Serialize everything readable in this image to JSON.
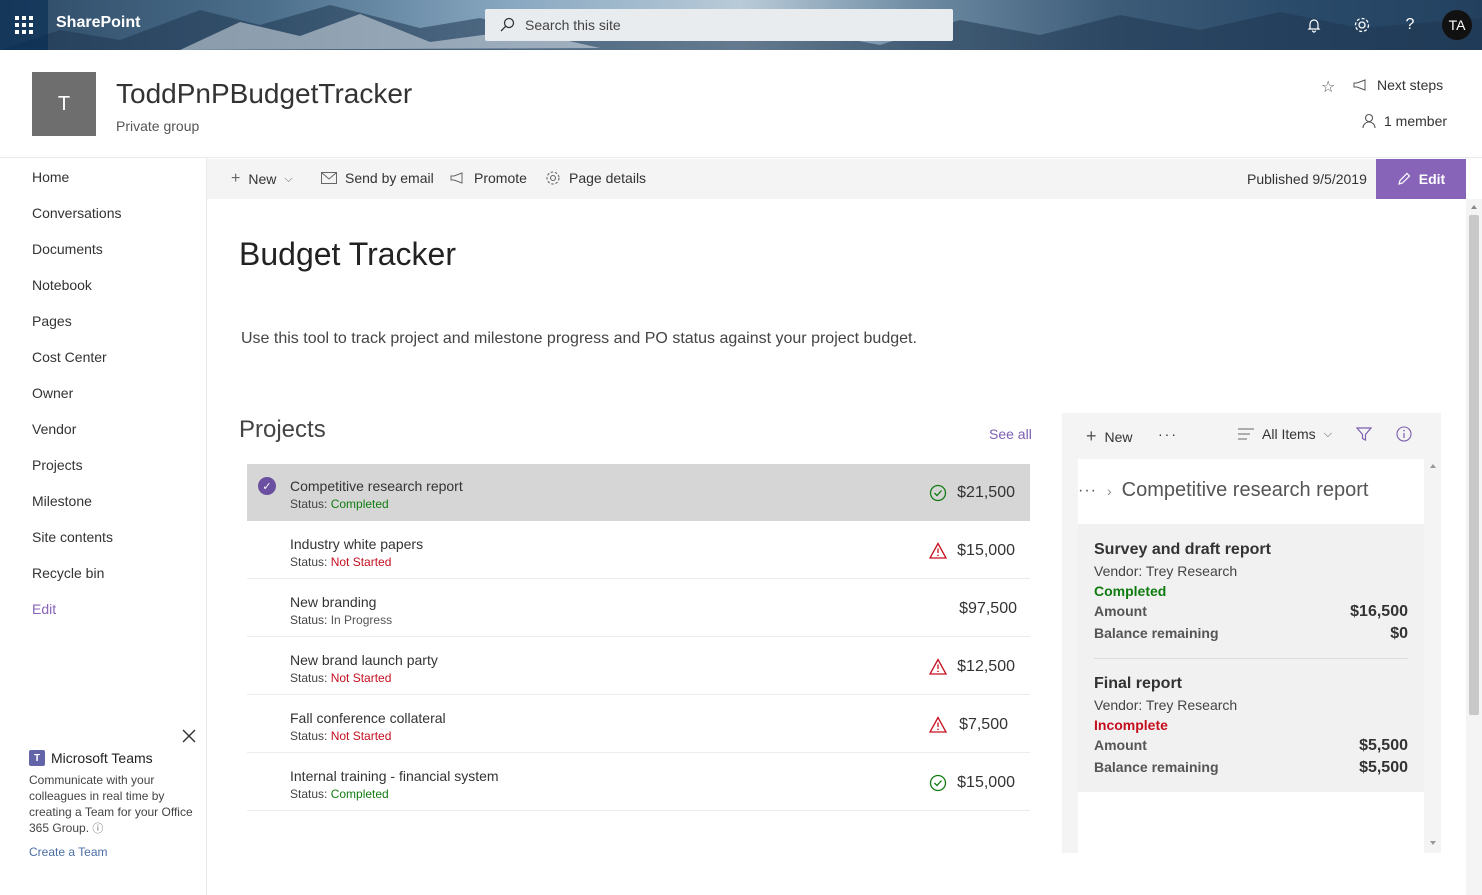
{
  "suite": {
    "brand": "SharePoint",
    "search_placeholder": "Search this site",
    "avatar_initials": "TA"
  },
  "site": {
    "logo_letter": "T",
    "title": "ToddPnPBudgetTracker",
    "subtitle": "Private group",
    "next_steps": "Next steps",
    "members": "1 member"
  },
  "nav": {
    "items": [
      "Home",
      "Conversations",
      "Documents",
      "Notebook",
      "Pages",
      "Cost Center",
      "Owner",
      "Vendor",
      "Projects",
      "Milestone",
      "Site contents",
      "Recycle bin"
    ],
    "edit": "Edit"
  },
  "teams": {
    "title": "Microsoft Teams",
    "description": "Communicate with your colleagues in real time by creating a Team for your Office 365 Group.",
    "link": "Create a Team"
  },
  "command": {
    "new": "New",
    "send_email": "Send by email",
    "promote": "Promote",
    "page_details": "Page details",
    "published": "Published 9/5/2019",
    "edit": "Edit"
  },
  "page": {
    "title": "Budget Tracker",
    "description": "Use this tool to track project and milestone progress and PO status against your project budget."
  },
  "projects": {
    "title": "Projects",
    "see_all": "See all",
    "status_label": "Status:",
    "rows": [
      {
        "name": "Competitive research report",
        "status": "Completed",
        "amount": "$21,500",
        "icon": "check-circle-icon"
      },
      {
        "name": "Industry white papers",
        "status": "Not Started",
        "amount": "$15,000",
        "icon": "warning-icon"
      },
      {
        "name": "New branding",
        "status": "In Progress",
        "amount": "$97,500",
        "icon": ""
      },
      {
        "name": "New brand launch party",
        "status": "Not Started",
        "amount": "$12,500",
        "icon": "warning-icon"
      },
      {
        "name": "Fall conference collateral",
        "status": "Not Started",
        "amount": "$7,500",
        "icon": "warning-icon"
      },
      {
        "name": "Internal training - financial system",
        "status": "Completed",
        "amount": "$15,000",
        "icon": "check-circle-icon"
      }
    ]
  },
  "list_panel": {
    "new": "New",
    "more": "···",
    "view": "All Items",
    "breadcrumb_more": "···",
    "breadcrumb_title": "Competitive research report",
    "milestones": [
      {
        "title": "Survey and draft report",
        "vendor": "Vendor: Trey Research",
        "state": "Completed",
        "amount_label": "Amount",
        "amount": "$16,500",
        "balance_label": "Balance remaining",
        "balance": "$0"
      },
      {
        "title": "Final report",
        "vendor": "Vendor: Trey Research",
        "state": "Incomplete",
        "amount_label": "Amount",
        "amount": "$5,500",
        "balance_label": "Balance remaining",
        "balance": "$5,500"
      }
    ]
  },
  "colors": {
    "accent": "#8764b8",
    "completed": "#107c10",
    "not_started": "#c50f1f"
  }
}
